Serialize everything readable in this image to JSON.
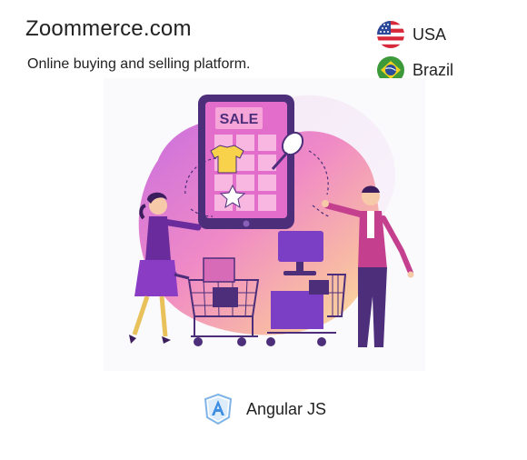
{
  "project": {
    "title": "Zoommerce.com",
    "description": "Online buying and selling platform."
  },
  "countries": [
    {
      "name": "USA",
      "icon": "usa-flag-icon"
    },
    {
      "name": "Brazil",
      "icon": "brazil-flag-icon"
    }
  ],
  "illustration": {
    "sale_label": "SALE"
  },
  "technology": {
    "name": "Angular JS",
    "icon": "angular-icon"
  }
}
